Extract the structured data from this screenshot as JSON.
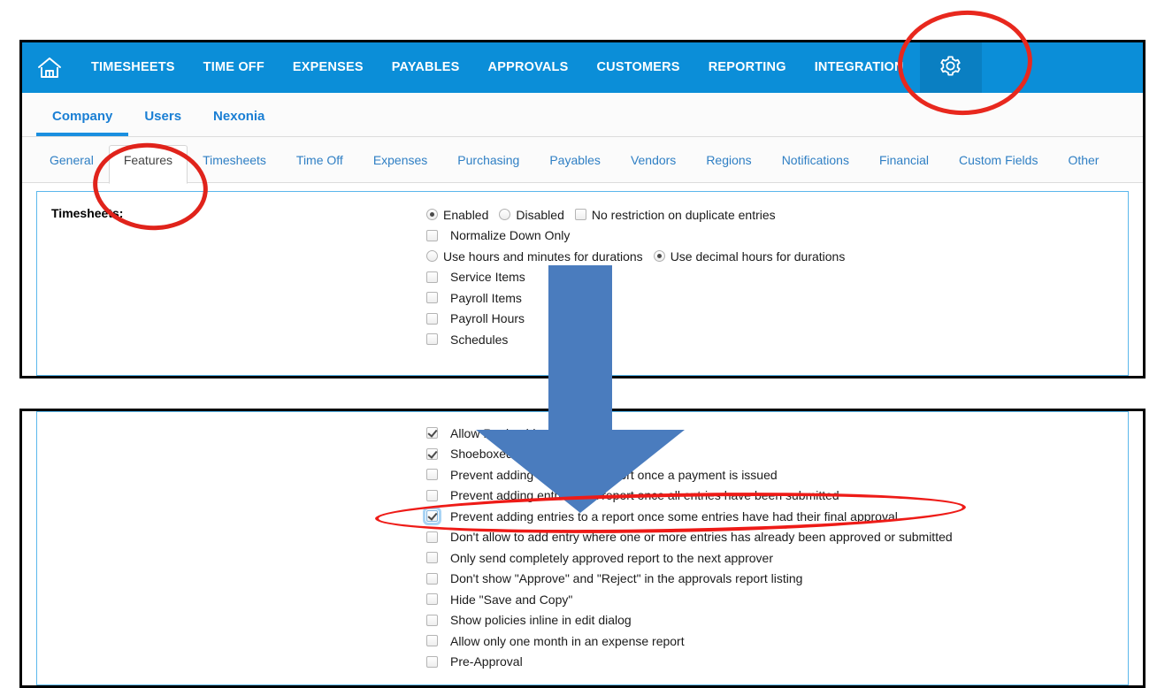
{
  "nav": {
    "home_icon": "home-icon",
    "items": [
      "TIMESHEETS",
      "TIME OFF",
      "EXPENSES",
      "PAYABLES",
      "APPROVALS",
      "CUSTOMERS",
      "REPORTING",
      "INTEGRATION"
    ],
    "gear_icon": "gear-icon",
    "bar_color": "#0b8ed8",
    "gear_cell_color": "#0a7fc2"
  },
  "primary_tabs": [
    {
      "label": "Company",
      "active": true
    },
    {
      "label": "Users",
      "active": false
    },
    {
      "label": "Nexonia",
      "active": false
    }
  ],
  "secondary_tabs": [
    {
      "label": "General",
      "active": false
    },
    {
      "label": "Features",
      "active": true
    },
    {
      "label": "Timesheets",
      "active": false
    },
    {
      "label": "Time Off",
      "active": false
    },
    {
      "label": "Expenses",
      "active": false
    },
    {
      "label": "Purchasing",
      "active": false
    },
    {
      "label": "Payables",
      "active": false
    },
    {
      "label": "Vendors",
      "active": false
    },
    {
      "label": "Regions",
      "active": false
    },
    {
      "label": "Notifications",
      "active": false
    },
    {
      "label": "Financial",
      "active": false
    },
    {
      "label": "Custom Fields",
      "active": false
    },
    {
      "label": "Other",
      "active": false
    }
  ],
  "timesheets_panel": {
    "section_label": "Timesheets:",
    "row_enabled": {
      "enabled_label": "Enabled",
      "disabled_label": "Disabled",
      "no_restriction_label": "No restriction on duplicate entries",
      "enabled_selected": true,
      "disabled_selected": false,
      "no_restriction_checked": false
    },
    "row_normalize": {
      "label": "Normalize Down Only",
      "checked": false
    },
    "row_durations": {
      "hours_minutes_label": "Use hours and minutes for durations",
      "hours_minutes_selected": false,
      "decimal_label": "Use decimal hours for durations",
      "decimal_selected": true
    },
    "options": [
      {
        "label": "Service Items",
        "checked": false
      },
      {
        "label": "Payroll Items",
        "checked": false
      },
      {
        "label": "Payroll Hours",
        "checked": false
      },
      {
        "label": "Schedules",
        "checked": false
      }
    ]
  },
  "bottom_panel": {
    "options": [
      {
        "label": "Allow Region hierarchy tagging",
        "checked": true,
        "focused": false,
        "occluded": true
      },
      {
        "label": "Shoeboxed Access",
        "checked": true,
        "focused": false,
        "occluded": false
      },
      {
        "label": "Prevent adding entries to a report once a payment is issued",
        "checked": false,
        "focused": false,
        "occluded": false
      },
      {
        "label": "Prevent adding entries to a report once all entries have been submitted",
        "checked": false,
        "focused": false,
        "occluded": false
      },
      {
        "label": "Prevent adding entries to a report once some entries have had their final approval",
        "checked": true,
        "focused": true,
        "occluded": false
      },
      {
        "label": "Don't allow to add entry where one or more entries has already been approved or submitted",
        "checked": false,
        "focused": false,
        "occluded": false
      },
      {
        "label": "Only send completely approved report to the next approver",
        "checked": false,
        "focused": false,
        "occluded": false
      },
      {
        "label": "Don't show \"Approve\" and \"Reject\" in the approvals report listing",
        "checked": false,
        "focused": false,
        "occluded": false
      },
      {
        "label": "Hide \"Save and Copy\"",
        "checked": false,
        "focused": false,
        "occluded": false
      },
      {
        "label": "Show policies inline in edit dialog",
        "checked": false,
        "focused": false,
        "occluded": false
      },
      {
        "label": "Allow only one month in an expense report",
        "checked": false,
        "focused": false,
        "occluded": false
      },
      {
        "label": "Pre-Approval",
        "checked": false,
        "focused": false,
        "occluded": false
      }
    ]
  },
  "annotations": {
    "circle_gear": {
      "name": "red-circle-gear-icon",
      "color": "#e8281e"
    },
    "circle_features": {
      "name": "red-circle-features-tab",
      "color": "#e0231b"
    },
    "ellipse_checkbox": {
      "name": "red-ellipse-final-approval-checkbox",
      "color": "#ee1b17"
    },
    "arrow": {
      "name": "blue-down-arrow",
      "color": "#4a7cbe"
    }
  }
}
